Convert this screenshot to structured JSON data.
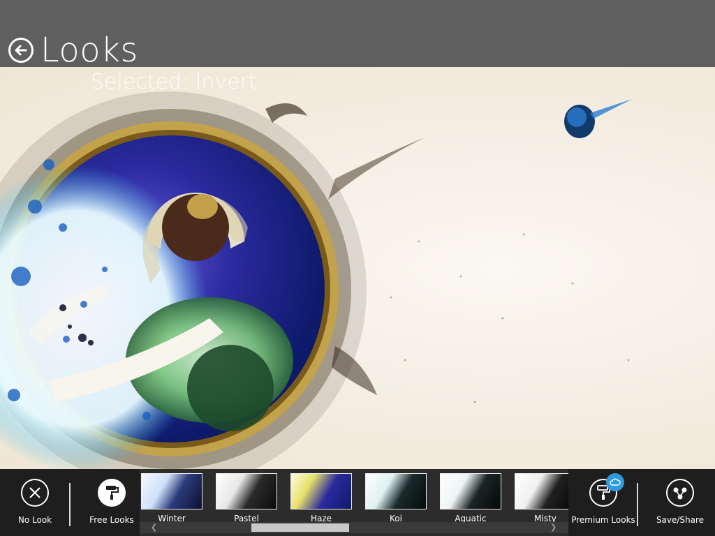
{
  "header": {
    "title": "Looks",
    "back_icon": "back-arrow-icon"
  },
  "photo": {
    "selected_text": "Selected: Invert"
  },
  "appbar": {
    "no_look_label": "No Look",
    "free_looks_label": "Free Looks",
    "premium_looks_label": "Premium Looks",
    "save_share_label": "Save/Share",
    "looks": [
      {
        "label": "Winter"
      },
      {
        "label": "Pastel"
      },
      {
        "label": "Haze"
      },
      {
        "label": "Koi"
      },
      {
        "label": "Aquatic"
      },
      {
        "label": "Misty"
      }
    ]
  },
  "colors": {
    "header_bg": "#5f5f5f",
    "appbar_bg": "#1e1e1e",
    "badge": "#2f9ae0"
  }
}
